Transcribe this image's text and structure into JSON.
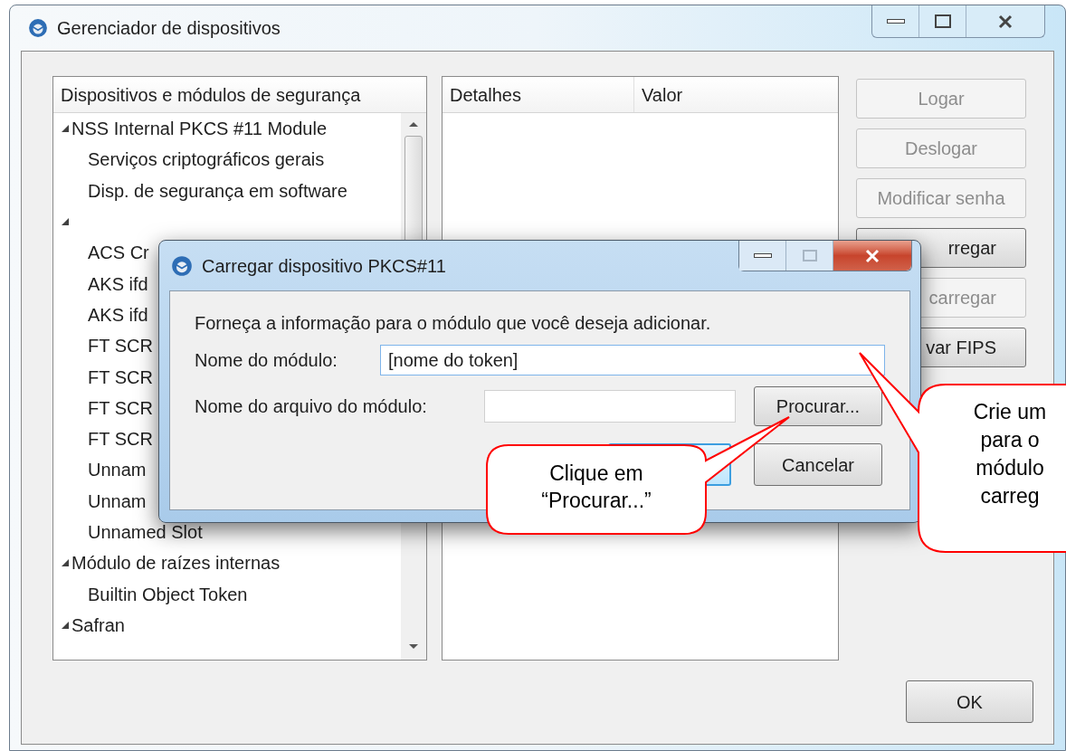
{
  "window": {
    "title": "Gerenciador de dispositivos"
  },
  "tree": {
    "column": "Dispositivos e módulos de segurança",
    "items": [
      {
        "name": "NSS Internal PKCS #11 Module",
        "expanded": true,
        "children": [
          {
            "name": "Serviços criptográficos gerais"
          },
          {
            "name": "Disp. de segurança em software"
          }
        ]
      },
      {
        "expanded": true,
        "children": [
          {
            "name": "ACS Cr"
          },
          {
            "name": "AKS ifd"
          },
          {
            "name": "AKS ifd"
          },
          {
            "name": "FT SCR"
          },
          {
            "name": "FT SCR"
          },
          {
            "name": "FT SCR"
          },
          {
            "name": "FT SCR"
          },
          {
            "name": "Unnam"
          },
          {
            "name": "Unnam"
          },
          {
            "name": "Unnamed Slot"
          }
        ]
      },
      {
        "name": "Módulo de raízes internas",
        "expanded": true,
        "children": [
          {
            "name": "Builtin Object Token"
          }
        ]
      },
      {
        "name": "Safran",
        "expanded": true
      }
    ]
  },
  "details": {
    "columns": [
      "Detalhes",
      "Valor"
    ]
  },
  "buttons": [
    {
      "label": "Logar",
      "disabled": true
    },
    {
      "label": "Deslogar",
      "disabled": true
    },
    {
      "label": "Modificar senha",
      "disabled": true
    },
    {
      "label": "rregar",
      "disabled": false
    },
    {
      "label": "carregar",
      "disabled": true
    },
    {
      "label": "var FIPS",
      "disabled": false
    }
  ],
  "ok_button": "OK",
  "dialog": {
    "title": "Carregar dispositivo PKCS#11",
    "intro": "Forneça a informação para o módulo que você deseja adicionar.",
    "module_name": {
      "label": "Nome do módulo:",
      "value": "[nome do token]"
    },
    "module_file": {
      "label": "Nome do arquivo do módulo:"
    },
    "browse_button": "Procurar...",
    "cancel_button": "Cancelar"
  },
  "callouts": [
    "Clique em\n“Procurar...”",
    "Crie um\npara o\nmódulo\ncarreg"
  ]
}
